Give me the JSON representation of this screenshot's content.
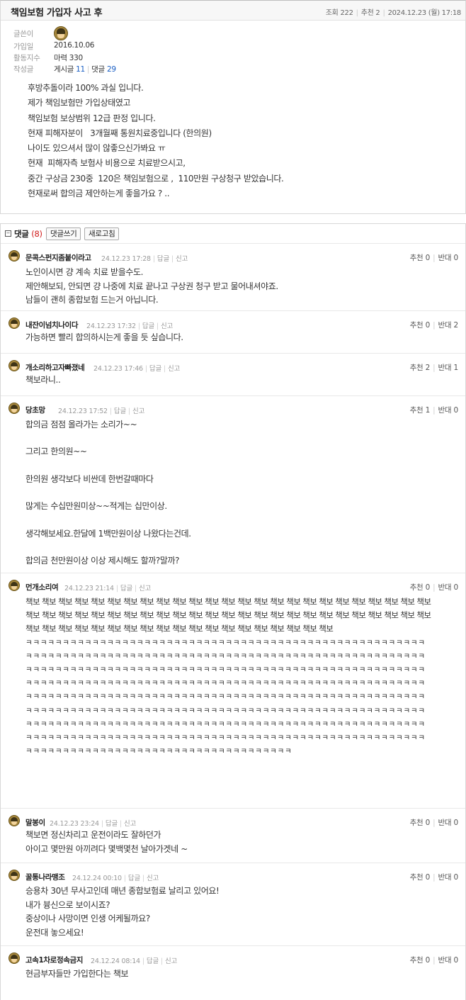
{
  "post": {
    "title": "책임보험 가입자 사고 후",
    "views_label": "조회",
    "views": "222",
    "recommend_label": "추천",
    "recommend": "2",
    "date": "2024.12.23 (월) 17:18",
    "author_label": "글쓴이",
    "joined_label": "가입일",
    "joined": "2016.10.06",
    "activity_label": "활동지수",
    "activity": "마력 330",
    "written_label": "작성글",
    "posts_label": "게시글",
    "posts_count": "11",
    "replies_label": "댓글",
    "replies_count": "29",
    "body": [
      "후방추돌이라 100% 과실 입니다.",
      "제가 책임보험만 가입상태였고",
      "책임보험 보상범위 12급 판정 입니다.",
      "현재 피해자분이   3개월째 통원치료중입니다 (한의원)",
      "나이도 있으셔서 많이 않좋으신가봐요 ㅠ",
      "현재  피해자측 보험사 비용으로 치료받으시고,",
      "중간 구상금 230중  120은 책임보험으로 ,  110만원 구상청구 받았습니다.",
      "현재로써 합의금 제안하는게 좋을가요 ? .."
    ]
  },
  "comments_section": {
    "toggle": "−",
    "title": "댓글",
    "count": "(8)",
    "write_button": "댓글쓰기",
    "refresh_button": "새로고침",
    "reply_label": "답글",
    "report_label": "신고",
    "up_label": "추천",
    "down_label": "반대",
    "comments": [
      {
        "author": "문콕스펀지좀붙이라고",
        "date": "24.12.23 17:28",
        "up": "0",
        "down": "0",
        "lines": [
          "노인이시면 걍 계속 치료 받을수도.",
          "제안해보되, 안되면 걍 나중에 치료 끝나고 구상권 청구 받고 물어내셔야죠.",
          "남들이 괜히 종합보험 드는거 아닙니다."
        ]
      },
      {
        "author": "내잔이넘치나이다",
        "date": "24.12.23 17:32",
        "up": "0",
        "down": "2",
        "lines": [
          "가능하면 빨리 합의하시는게 좋을 듯 싶습니다."
        ]
      },
      {
        "author": "개소리하고자빠졌네",
        "date": "24.12.23 17:46",
        "up": "2",
        "down": "1",
        "lines": [
          "책보라니.."
        ]
      },
      {
        "author": "당초망",
        "date": "24.12.23 17:52",
        "up": "1",
        "down": "0",
        "lines": [
          "합의금 점점 올라가는 소리가~~",
          "",
          "그리고 한의원~~",
          "",
          "한의원 생각보다 비싼데 한번갈때마다",
          "",
          "많게는 수십만원미상~~적게는 십만이상.",
          "",
          "생각해보세요.한달에 1백만원이상 나왔다는건데.",
          "",
          "합의금 천만원이상 이상 제시해도 할까?말까?"
        ]
      },
      {
        "author": "먼개소리여",
        "date": "24.12.23 21:14",
        "up": "0",
        "down": "0",
        "paragraphs": [
          "책보 책보 책보 책보 책보 책보 책보 책보 책보 책보 책보 책보 책보 책보 책보 책보 책보 책보 책보 책보 책보 책보 책보 책보 책보 책보 책보 책보 책보 책보 책보 책보 책보 책보 책보 책보 책보 책보 책보 책보 책보 책보 책보 책보 책보 책보 책보 책보 책보 책보 책보 책보 책보 책보 책보 책보 책보 책보 책보 책보 책보 책보 책보 책보 책보 책보 책보 책보 책보",
          "ㅋㅋㅋㅋㅋㅋㅋㅋㅋㅋㅋㅋㅋㅋㅋㅋㅋㅋㅋㅋㅋㅋㅋㅋㅋㅋㅋㅋㅋㅋㅋㅋㅋㅋㅋㅋㅋㅋㅋㅋㅋㅋㅋㅋㅋㅋㅋㅋㅋㅋㅋㅋㅋㅋㅋㅋㅋㅋㅋㅋㅋㅋㅋㅋㅋㅋㅋㅋㅋㅋㅋㅋㅋㅋㅋㅋㅋㅋㅋㅋㅋㅋㅋㅋㅋㅋㅋㅋㅋㅋㅋㅋㅋㅋㅋㅋㅋㅋㅋㅋㅋㅋㅋㅋㅋㅋㅋㅋㅋㅋㅋㅋㅋㅋㅋㅋㅋㅋㅋㅋㅋㅋㅋㅋㅋㅋㅋㅋㅋㅋㅋㅋㅋㅋㅋㅋㅋㅋㅋㅋㅋㅋㅋㅋㅋㅋㅋㅋㅋㅋㅋㅋㅋㅋㅋㅋㅋㅋㅋㅋㅋㅋㅋㅋㅋㅋㅋㅋㅋㅋㅋㅋㅋㅋㅋㅋㅋㅋㅋㅋㅋㅋㅋㅋㅋㅋㅋㅋㅋㅋㅋㅋㅋㅋㅋㅋㅋㅋㅋㅋㅋㅋㅋㅋㅋㅋㅋㅋㅋㅋㅋㅋㅋㅋㅋㅋㅋㅋㅋㅋㅋㅋㅋㅋㅋㅋㅋㅋㅋㅋㅋㅋㅋㅋㅋㅋㅋㅋㅋㅋㅋㅋㅋㅋㅋㅋㅋㅋㅋㅋㅋㅋㅋㅋㅋㅋㅋㅋㅋㅋㅋㅋㅋㅋㅋㅋㅋㅋㅋㅋㅋㅋㅋㅋㅋㅋㅋㅋㅋㅋㅋㅋㅋㅋㅋㅋㅋㅋㅋㅋㅋㅋㅋㅋㅋㅋㅋㅋㅋㅋㅋㅋㅋㅋㅋㅋㅋㅋㅋㅋㅋㅋㅋㅋㅋㅋㅋㅋㅋㅋㅋㅋㅋㅋㅋㅋㅋㅋㅋㅋㅋㅋㅋㅋㅋㅋㅋㅋㅋㅋㅋㅋㅋㅋㅋㅋㅋㅋㅋㅋㅋㅋㅋㅋㅋㅋㅋㅋㅋㅋㅋㅋㅋㅋㅋㅋㅋㅋㅋㅋㅋㅋㅋㅋㅋㅋㅋㅋㅋㅋㅋㅋㅋㅋㅋㅋㅋㅋㅋㅋㅋㅋㅋㅋㅋㅋㅋㅋㅋㅋㅋㅋㅋㅋㅋㅋㅋㅋㅋㅋㅋㅋㅋㅋㅋㅋㅋㅋㅋㅋㅋㅋㅋㅋㅋㅋㅋㅋㅋㅋㅋㅋㅋㅋㅋㅋㅋㅋㅋㅋㅋㅋㅋㅋㅋㅋㅋㅋㅋㅋㅋㅋㅋㅋㅋㅋㅋㅋㅋㅋㅋㅋㅋㅋㅋㅋㅋㅋ"
        ]
      },
      {
        "author": "말봉이",
        "date": "24.12.23 23:24",
        "up": "0",
        "down": "0",
        "lines": [
          "책보면 정신차리고 운전이라도 잘하던가",
          "아이고 몇만원 아끼려다 몇백몇천 날아가겟네 ~"
        ]
      },
      {
        "author": "꿀통나라맹조",
        "date": "24.12.24 00:10",
        "up": "0",
        "down": "0",
        "lines": [
          "승용차 30년 무사고인데 매년 종합보험료 날리고 있어요!",
          "내가 븅신으로 보이시죠?",
          "중상이나 사망이면 인생 어케될까요?",
          "운전대 놓으세요!"
        ]
      },
      {
        "author": "고속1차로정속금지",
        "date": "24.12.24 08:14",
        "up": "0",
        "down": "0",
        "lines": [
          "현금부자들만 가입한다는 책보"
        ]
      }
    ]
  }
}
